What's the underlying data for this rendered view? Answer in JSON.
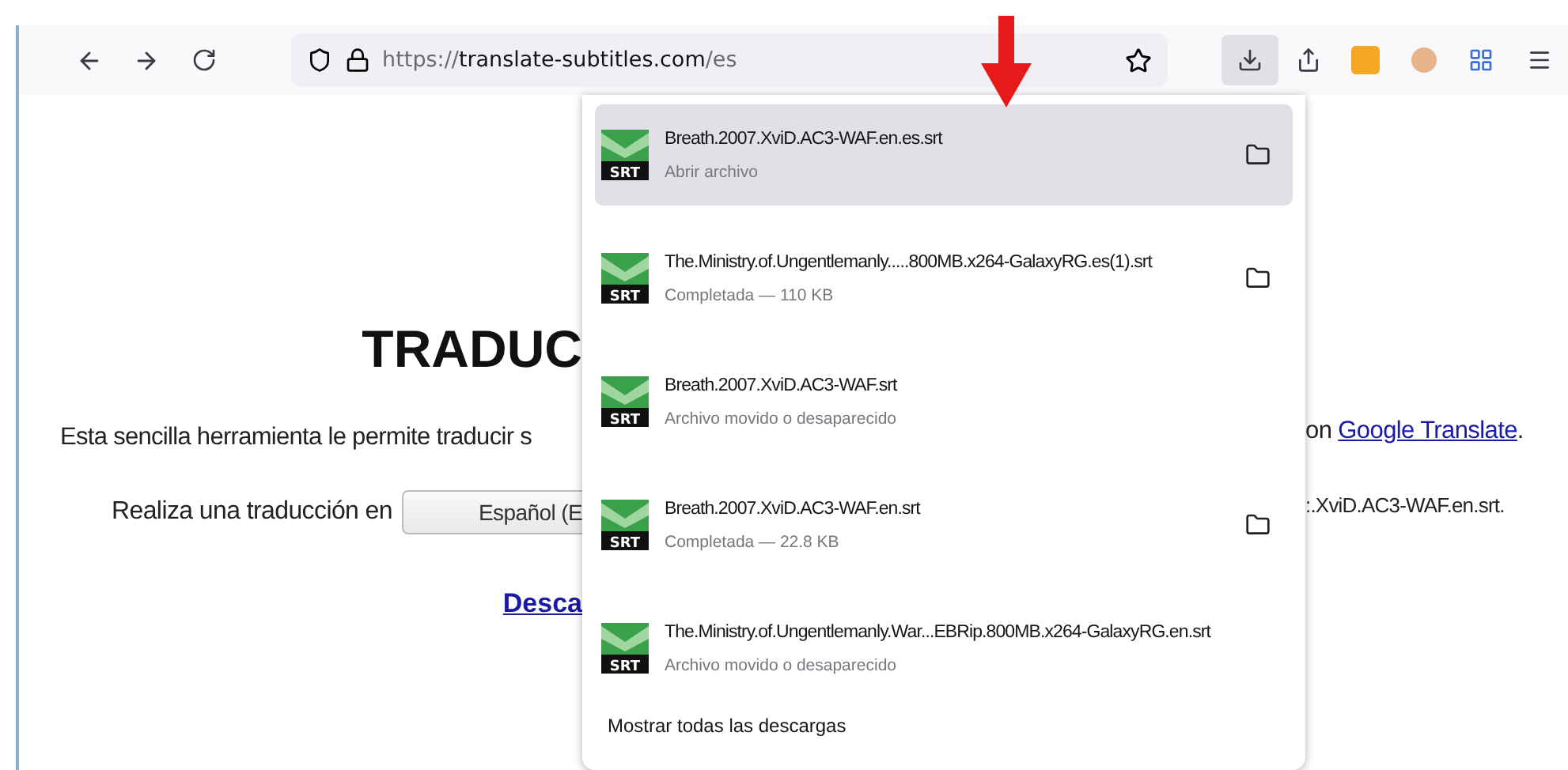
{
  "toolbar": {
    "url_scheme": "https://",
    "url_host": "translate-subtitles.com",
    "url_path": "/es",
    "downloads_open": true
  },
  "page": {
    "heading": "TRADUC",
    "intro": "Esta sencilla herramienta le permite traducir s",
    "intro_end": "on",
    "link": "Google Translate",
    "link_end": ".",
    "translate_label": "Realiza una traducción en",
    "language": "Español (E",
    "file_end": ":.XviD.AC3-WAF.en.srt.",
    "download_link": "Desca"
  },
  "downloads": {
    "items": [
      {
        "name": "Breath.2007.XviD.AC3-WAF.en.es.srt",
        "status": "Abrir archivo",
        "icon_label": "SRT",
        "highlighted": true,
        "folder_button": true
      },
      {
        "name": "The.Ministry.of.Ungentlemanly.....800MB.x264-GalaxyRG.es(1).srt",
        "status": "Completada — 110 KB",
        "icon_label": "SRT",
        "highlighted": false,
        "folder_button": true
      },
      {
        "name": "Breath.2007.XviD.AC3-WAF.srt",
        "status": "Archivo movido o desaparecido",
        "icon_label": "SRT",
        "highlighted": false,
        "folder_button": false
      },
      {
        "name": "Breath.2007.XviD.AC3-WAF.en.srt",
        "status": "Completada — 22.8 KB",
        "icon_label": "SRT",
        "highlighted": false,
        "folder_button": true
      },
      {
        "name": "The.Ministry.of.Ungentlemanly.War...EBRip.800MB.x264-GalaxyRG.en.srt",
        "status": "Archivo movido o desaparecido",
        "icon_label": "SRT",
        "highlighted": false,
        "folder_button": false
      }
    ],
    "show_all": "Mostrar todas las descargas"
  }
}
